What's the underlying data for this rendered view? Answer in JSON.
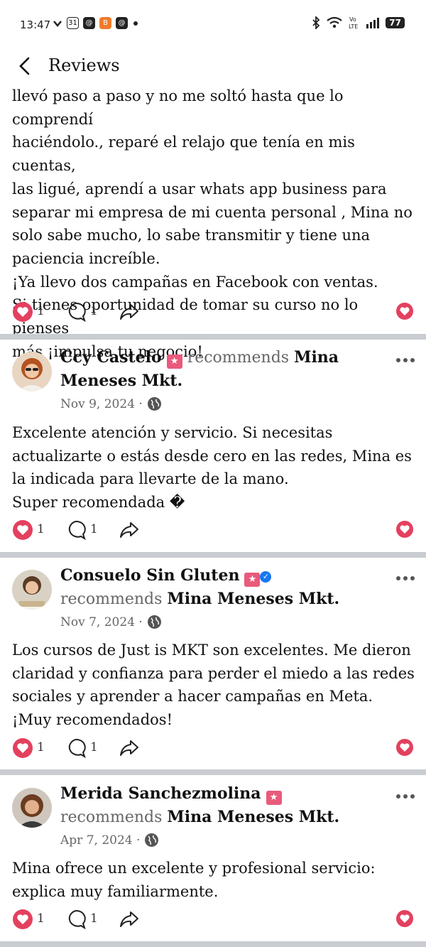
{
  "status_bar": {
    "time": "13:47",
    "battery": "77",
    "date_badge": "31"
  },
  "header": {
    "title": "Reviews"
  },
  "first_review": {
    "text_lines": [
      "llevó paso a paso y no me soltó hasta que lo comprendí",
      "haciéndolo., reparé el relajo que tenía en mis cuentas,",
      "las ligué, aprendí a usar whats app business para",
      "separar mi empresa de mi cuenta personal , Mina no",
      "solo sabe mucho, lo sabe transmitir y tiene una",
      "paciencia increíble.",
      "¡Ya llevo dos campañas en Facebook con ventas.",
      "Si tienes oportunidad de tomar su curso no lo pienses",
      "más ¡impulsa tu negocio!"
    ],
    "reactions": "1",
    "comments": "1"
  },
  "reviews": [
    {
      "name": "Ccy Castelo",
      "recommends": "recommends",
      "page": "Mina Meneses Mkt.",
      "date": "Nov 9, 2024 ·",
      "text": "Excelente atención y servicio. Si necesitas actualizarte o estás desde cero en las redes, Mina es la indicada para llevarte de la mano.",
      "text2": "Super recomendada �",
      "reactions": "1",
      "comments": "1"
    },
    {
      "name": "Consuelo Sin Gluten",
      "recommends": "recommends",
      "page": "Mina Meneses Mkt.",
      "date": "Nov 7, 2024 ·",
      "text": "Los cursos de Just is MKT son excelentes. Me dieron claridad y confianza para perder el miedo a las redes sociales y aprender a hacer campañas en Meta. ¡Muy recomendados!",
      "reactions": "1",
      "comments": "1"
    },
    {
      "name": "Merida Sanchezmolina",
      "recommends": "recommends",
      "page": "Mina Meneses Mkt.",
      "date": "Apr 7, 2024 ·",
      "text": "Mina ofrece un excelente y profesional servicio: explica muy familiarmente.",
      "reactions": "1",
      "comments": "1"
    }
  ],
  "colors": {
    "accent": "#e4405f",
    "verified": "#1877f2",
    "divider": "#c9ccd1"
  }
}
